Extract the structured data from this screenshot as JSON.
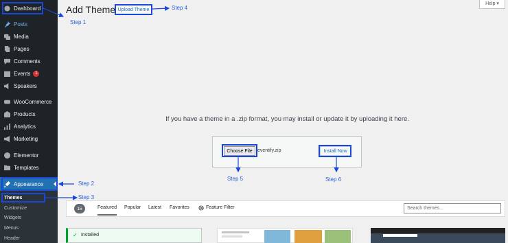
{
  "sidebar": {
    "items": [
      {
        "label": "Dashboard",
        "icon": "dashboard-icon"
      },
      {
        "label": "Posts",
        "icon": "pin-icon"
      },
      {
        "label": "Media",
        "icon": "media-icon"
      },
      {
        "label": "Pages",
        "icon": "pages-icon"
      },
      {
        "label": "Comments",
        "icon": "comment-icon"
      },
      {
        "label": "Events",
        "icon": "calendar-icon",
        "badge": "1"
      },
      {
        "label": "Speakers",
        "icon": "speaker-icon"
      },
      {
        "label": "WooCommerce",
        "icon": "woo-icon"
      },
      {
        "label": "Products",
        "icon": "products-icon"
      },
      {
        "label": "Analytics",
        "icon": "analytics-icon"
      },
      {
        "label": "Marketing",
        "icon": "megaphone-icon"
      },
      {
        "label": "Elementor",
        "icon": "elementor-icon"
      },
      {
        "label": "Templates",
        "icon": "folder-icon"
      },
      {
        "label": "Appearance",
        "icon": "brush-icon"
      }
    ],
    "submenu": [
      "Themes",
      "Customize",
      "Widgets",
      "Menus",
      "Header"
    ]
  },
  "header": {
    "title": "Add Themes",
    "upload_button": "Upload Theme",
    "help": "Help ▾"
  },
  "upload": {
    "instruction": "If you have a theme in a .zip format, you may install or update it by uploading it here.",
    "choose_file": "Choose File",
    "file_name": "eventify.zip",
    "install_button": "Install Now"
  },
  "filter": {
    "count": "15",
    "tabs": [
      "Featured",
      "Popular",
      "Latest",
      "Favorites"
    ],
    "feature_filter": "Feature Filter",
    "search_placeholder": "Search themes..."
  },
  "cards": {
    "installed": "Installed"
  },
  "steps": {
    "step1": "Step 1",
    "step2": "Step 2",
    "step3": "Step 3",
    "step4": "Step 4",
    "step5": "Step 5",
    "step6": "Step 6"
  },
  "colors": {
    "sidebar_bg": "#1d2327",
    "accent": "#2271b1",
    "annotation": "#1a48d6"
  }
}
